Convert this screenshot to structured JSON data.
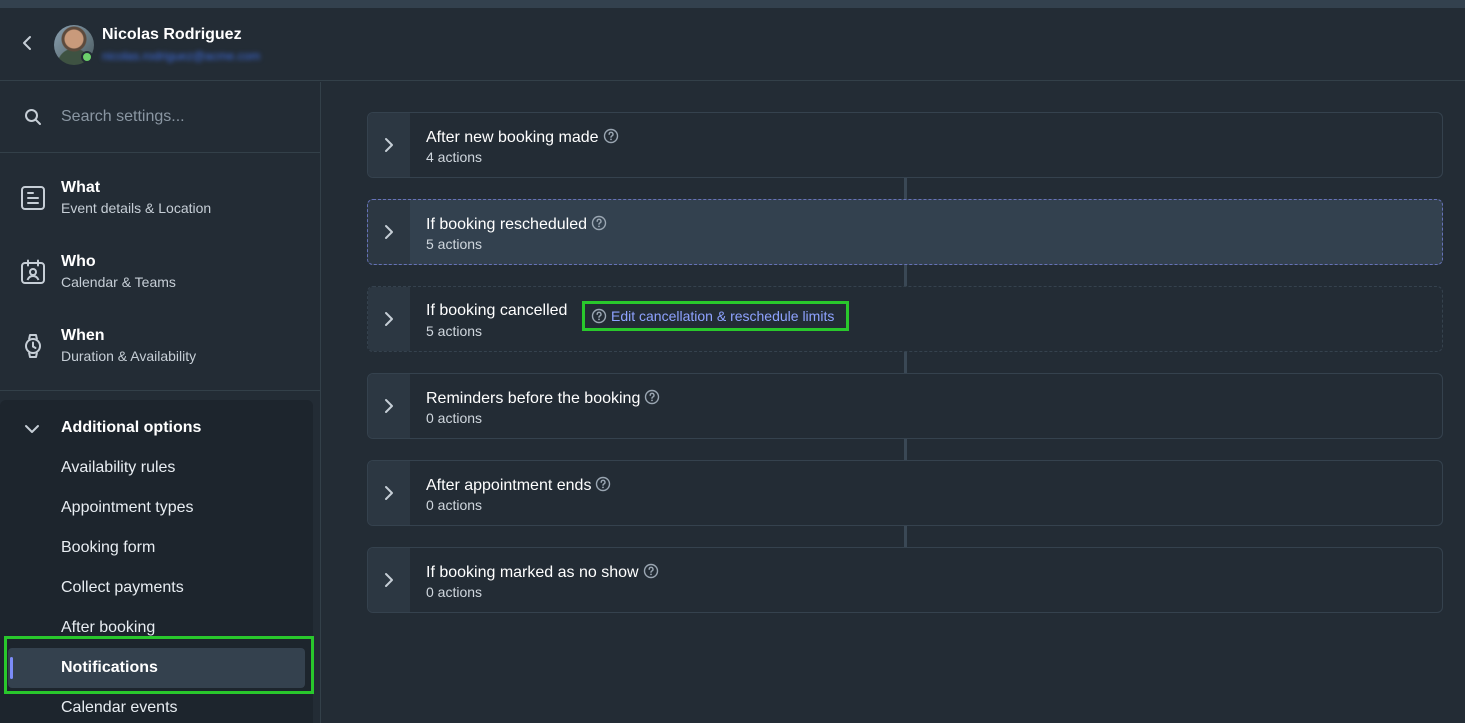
{
  "header": {
    "user_name": "Nicolas Rodriguez",
    "user_email": "nicolas.rodriguez@acme.com"
  },
  "icons": {
    "back": "chevron-left-icon",
    "search": "search-icon",
    "what": "document-icon",
    "who": "calendar-user-icon",
    "when": "watch-icon",
    "collapse": "chevron-down-icon",
    "expand": "chevron-right-icon",
    "help": "help-circle-icon"
  },
  "colors": {
    "accent": "#7c8cf8",
    "link": "#8ea2ff",
    "highlight": "#29c82c",
    "status_online": "#6bd16b"
  },
  "search": {
    "placeholder": "Search settings..."
  },
  "sidebar": {
    "sections": [
      {
        "title": "What",
        "subtitle": "Event details & Location"
      },
      {
        "title": "Who",
        "subtitle": "Calendar & Teams"
      },
      {
        "title": "When",
        "subtitle": "Duration & Availability"
      }
    ],
    "additional": {
      "title": "Additional options",
      "items": [
        "Availability rules",
        "Appointment types",
        "Booking form",
        "Collect payments",
        "After booking",
        "Notifications",
        "Calendar events"
      ],
      "active": "Notifications"
    }
  },
  "main": {
    "triggers": [
      {
        "title": "After new booking made",
        "count": "4 actions"
      },
      {
        "title": "If booking rescheduled",
        "count": "5 actions"
      },
      {
        "title": "If booking cancelled",
        "count": "5 actions",
        "link": "Edit cancellation & reschedule limits"
      },
      {
        "title": "Reminders before the booking",
        "count": "0 actions"
      },
      {
        "title": "After appointment ends",
        "count": "0 actions"
      },
      {
        "title": "If booking marked as no show",
        "count": "0 actions"
      }
    ]
  }
}
